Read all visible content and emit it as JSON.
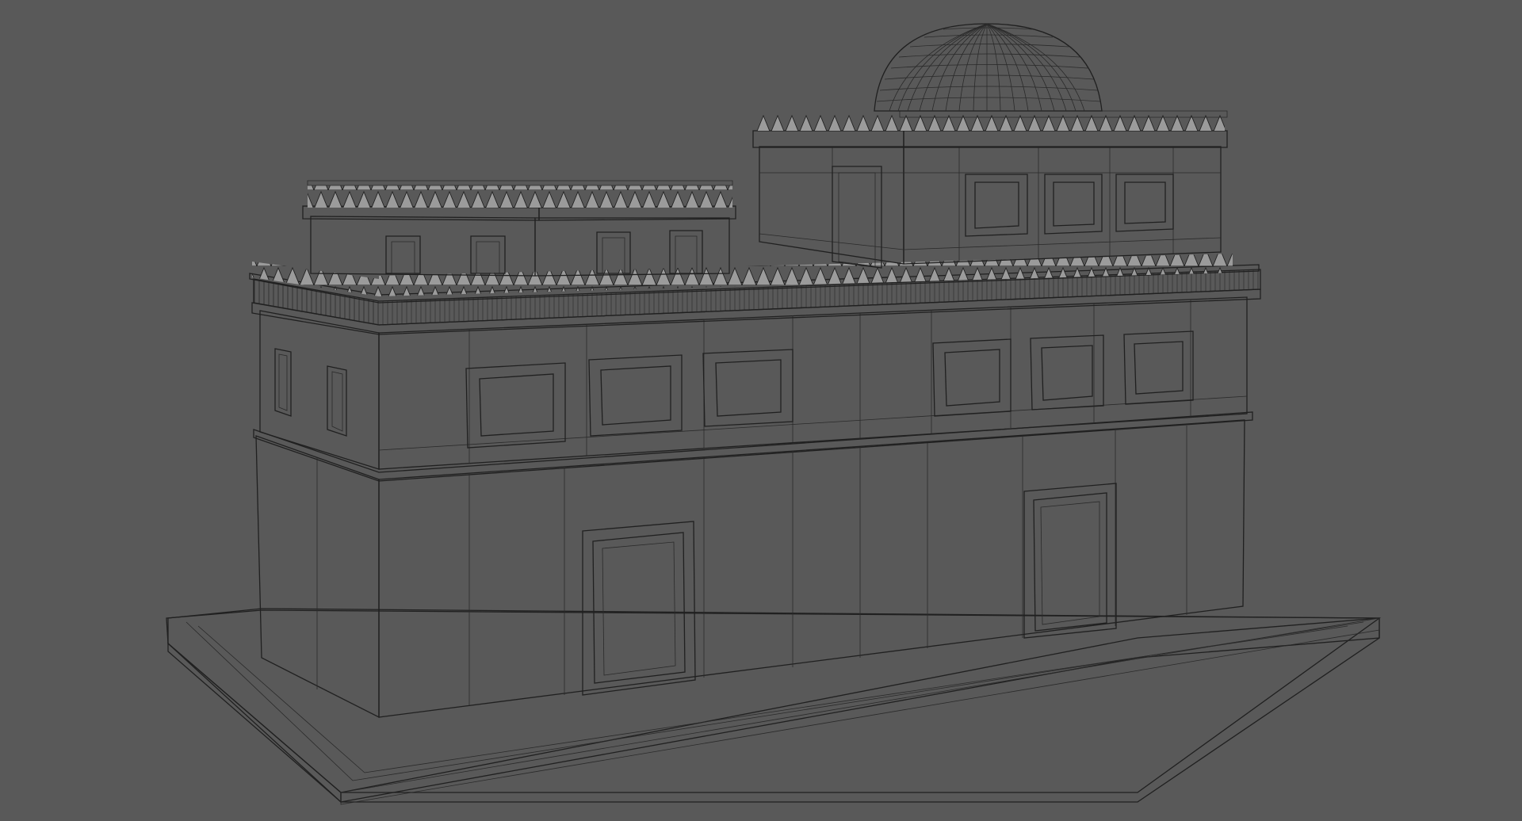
{
  "viewport": {
    "background_color": "#595959",
    "model_base_color": "#8c8c8c",
    "model_light_color": "#a6a6a6",
    "model_shadow_color": "#6f6f6f",
    "wire_color": "#202020"
  }
}
